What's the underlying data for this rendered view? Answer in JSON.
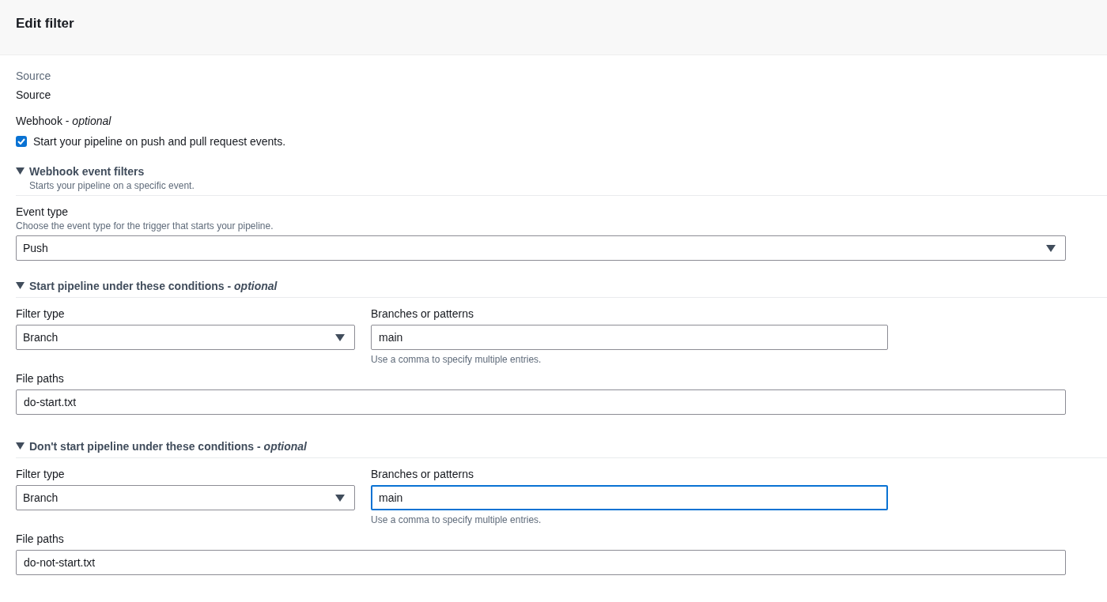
{
  "header": {
    "title": "Edit filter"
  },
  "source": {
    "label": "Source",
    "value": "Source"
  },
  "webhook": {
    "label": "Webhook - *optional*",
    "checkbox": {
      "label": "Start your pipeline on push and pull request events.",
      "checked": true
    }
  },
  "event_filters": {
    "title": "Webhook event filters",
    "description": "Starts your pipeline on a specific event.",
    "expanded": true
  },
  "event_type": {
    "label": "Event type",
    "description": "Choose the event type for the trigger that starts your pipeline.",
    "value": "Push"
  },
  "conditions": [
    {
      "title": "Start pipeline under these conditions - *optional*",
      "expanded": true,
      "filter_type": {
        "label": "Filter type",
        "value": "Branch"
      },
      "branches": {
        "label": "Branches or patterns",
        "value": "main",
        "hint": "Use a comma to specify multiple entries.",
        "focused": false
      },
      "file_paths": {
        "label": "File paths",
        "value": "do-start.txt"
      }
    },
    {
      "title": "Don't start pipeline under these conditions - *optional*",
      "expanded": true,
      "filter_type": {
        "label": "Filter type",
        "value": "Branch"
      },
      "branches": {
        "label": "Branches or patterns",
        "value": "main",
        "hint": "Use a comma to specify multiple entries.",
        "focused": true
      },
      "file_paths": {
        "label": "File paths",
        "value": "do-not-start.txt"
      }
    }
  ]
}
